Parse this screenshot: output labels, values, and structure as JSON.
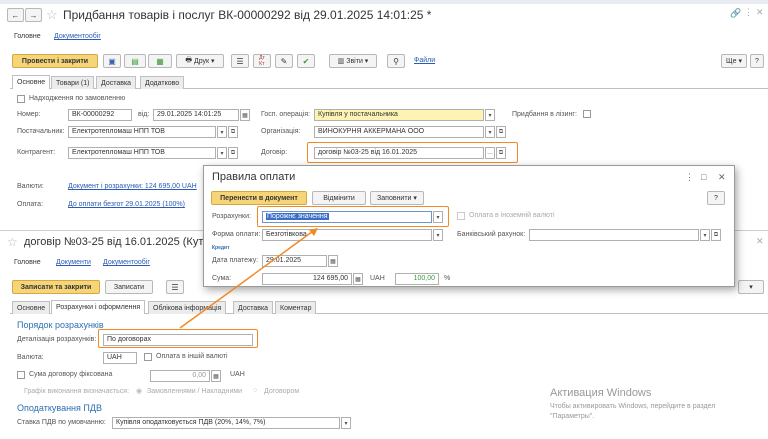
{
  "win1": {
    "title": "Придбання товарів і послуг ВК-00000292 від 29.01.2025 14:01:25 *",
    "nav": [
      "Головне",
      "Документообіг"
    ],
    "toolbar": {
      "post_close": "Провести і закрити",
      "print": "Друк",
      "reports": "Звіти",
      "files": "Файли",
      "more": "Ще",
      "help": "?"
    },
    "tabs": [
      "Основне",
      "Товари (1)",
      "Доставка",
      "Додатково"
    ],
    "fields": {
      "by_order_label": "Надходження по замовленню",
      "number_label": "Номер:",
      "number": "ВК-00000292",
      "date_label": "від:",
      "date": "29.01.2025 14:01:25",
      "op_label": "Госп. операція:",
      "op": "Купівля у постачальника",
      "leasing_label": "Придбання в лізинг:",
      "supplier_label": "Постачальник:",
      "supplier": "Електротепломаш НПП ТОВ",
      "org_label": "Організація:",
      "org": "ВИНОКУРНЯ АККЕРМАНА ООО",
      "contractor_label": "Контрагент:",
      "contractor": "Електротепломаш НПП ТОВ",
      "contract_label": "Договір:",
      "contract": "договір №03-25 від 16.01.2025",
      "currency_label": "Валюти:",
      "currency_link": "Документ і розрахунки: 124 695,00 UAH",
      "payment_label": "Оплата:",
      "payment_link": "До оплати безгот 29.01.2025 (100%)"
    }
  },
  "win2": {
    "title": "договір №03-25 від 16.01.2025 (Кут",
    "nav": [
      "Головне",
      "Документи",
      "Документообіг"
    ],
    "toolbar": {
      "save_close": "Записати та закрити",
      "save": "Записати"
    },
    "tabs": [
      "Основне",
      "Розрахунки і оформлення",
      "Облікова інформація",
      "Доставка",
      "Коментар"
    ],
    "section1": "Порядок розрахунків",
    "detail_label": "Деталізація розрахунків:",
    "detail": "По договорах",
    "currency_label": "Валюта:",
    "currency": "UAH",
    "other_currency": "Оплата в іншій валюті",
    "fixed_sum": "Сума договору фіксована",
    "fixed_value": "0,00",
    "fixed_currency": "UAH",
    "schedule_label": "Графік виконання визначається:",
    "schedule_opt1": "Замовленнями / Накладними",
    "schedule_opt2": "Договором",
    "section2": "Оподаткування ПДВ",
    "vat_label": "Ставка ПДВ по умовчанню:",
    "vat": "Купівля оподатковується ПДВ (20%, 14%, 7%)"
  },
  "dialog": {
    "title": "Правила оплати",
    "transfer": "Перенести в документ",
    "cancel": "Відмінити",
    "fill": "Заповнити",
    "help": "?",
    "settle_label": "Розрахунки:",
    "settle": "Порожнє значення",
    "foreign": "Оплата в іноземній валюті",
    "form_label": "Форма оплати:",
    "form": "Безготівкова",
    "bank_label": "Банківський рахунок:",
    "credit": "Кредит",
    "date_label": "Дата платежу:",
    "date": "29.01.2025",
    "sum_label": "Сума:",
    "sum": "124 695,00",
    "sum_currency": "UAH",
    "percent": "100,00",
    "percent_sign": "%"
  },
  "watermark": {
    "title": "Активация Windows",
    "line1": "Чтобы активировать Windows, перейдите в раздел",
    "line2": "\"Параметры\"."
  },
  "colors": {
    "accent": "#f08a24",
    "primary": "#f6d579",
    "link": "#2a5bb5",
    "section": "#2a6fb0"
  }
}
